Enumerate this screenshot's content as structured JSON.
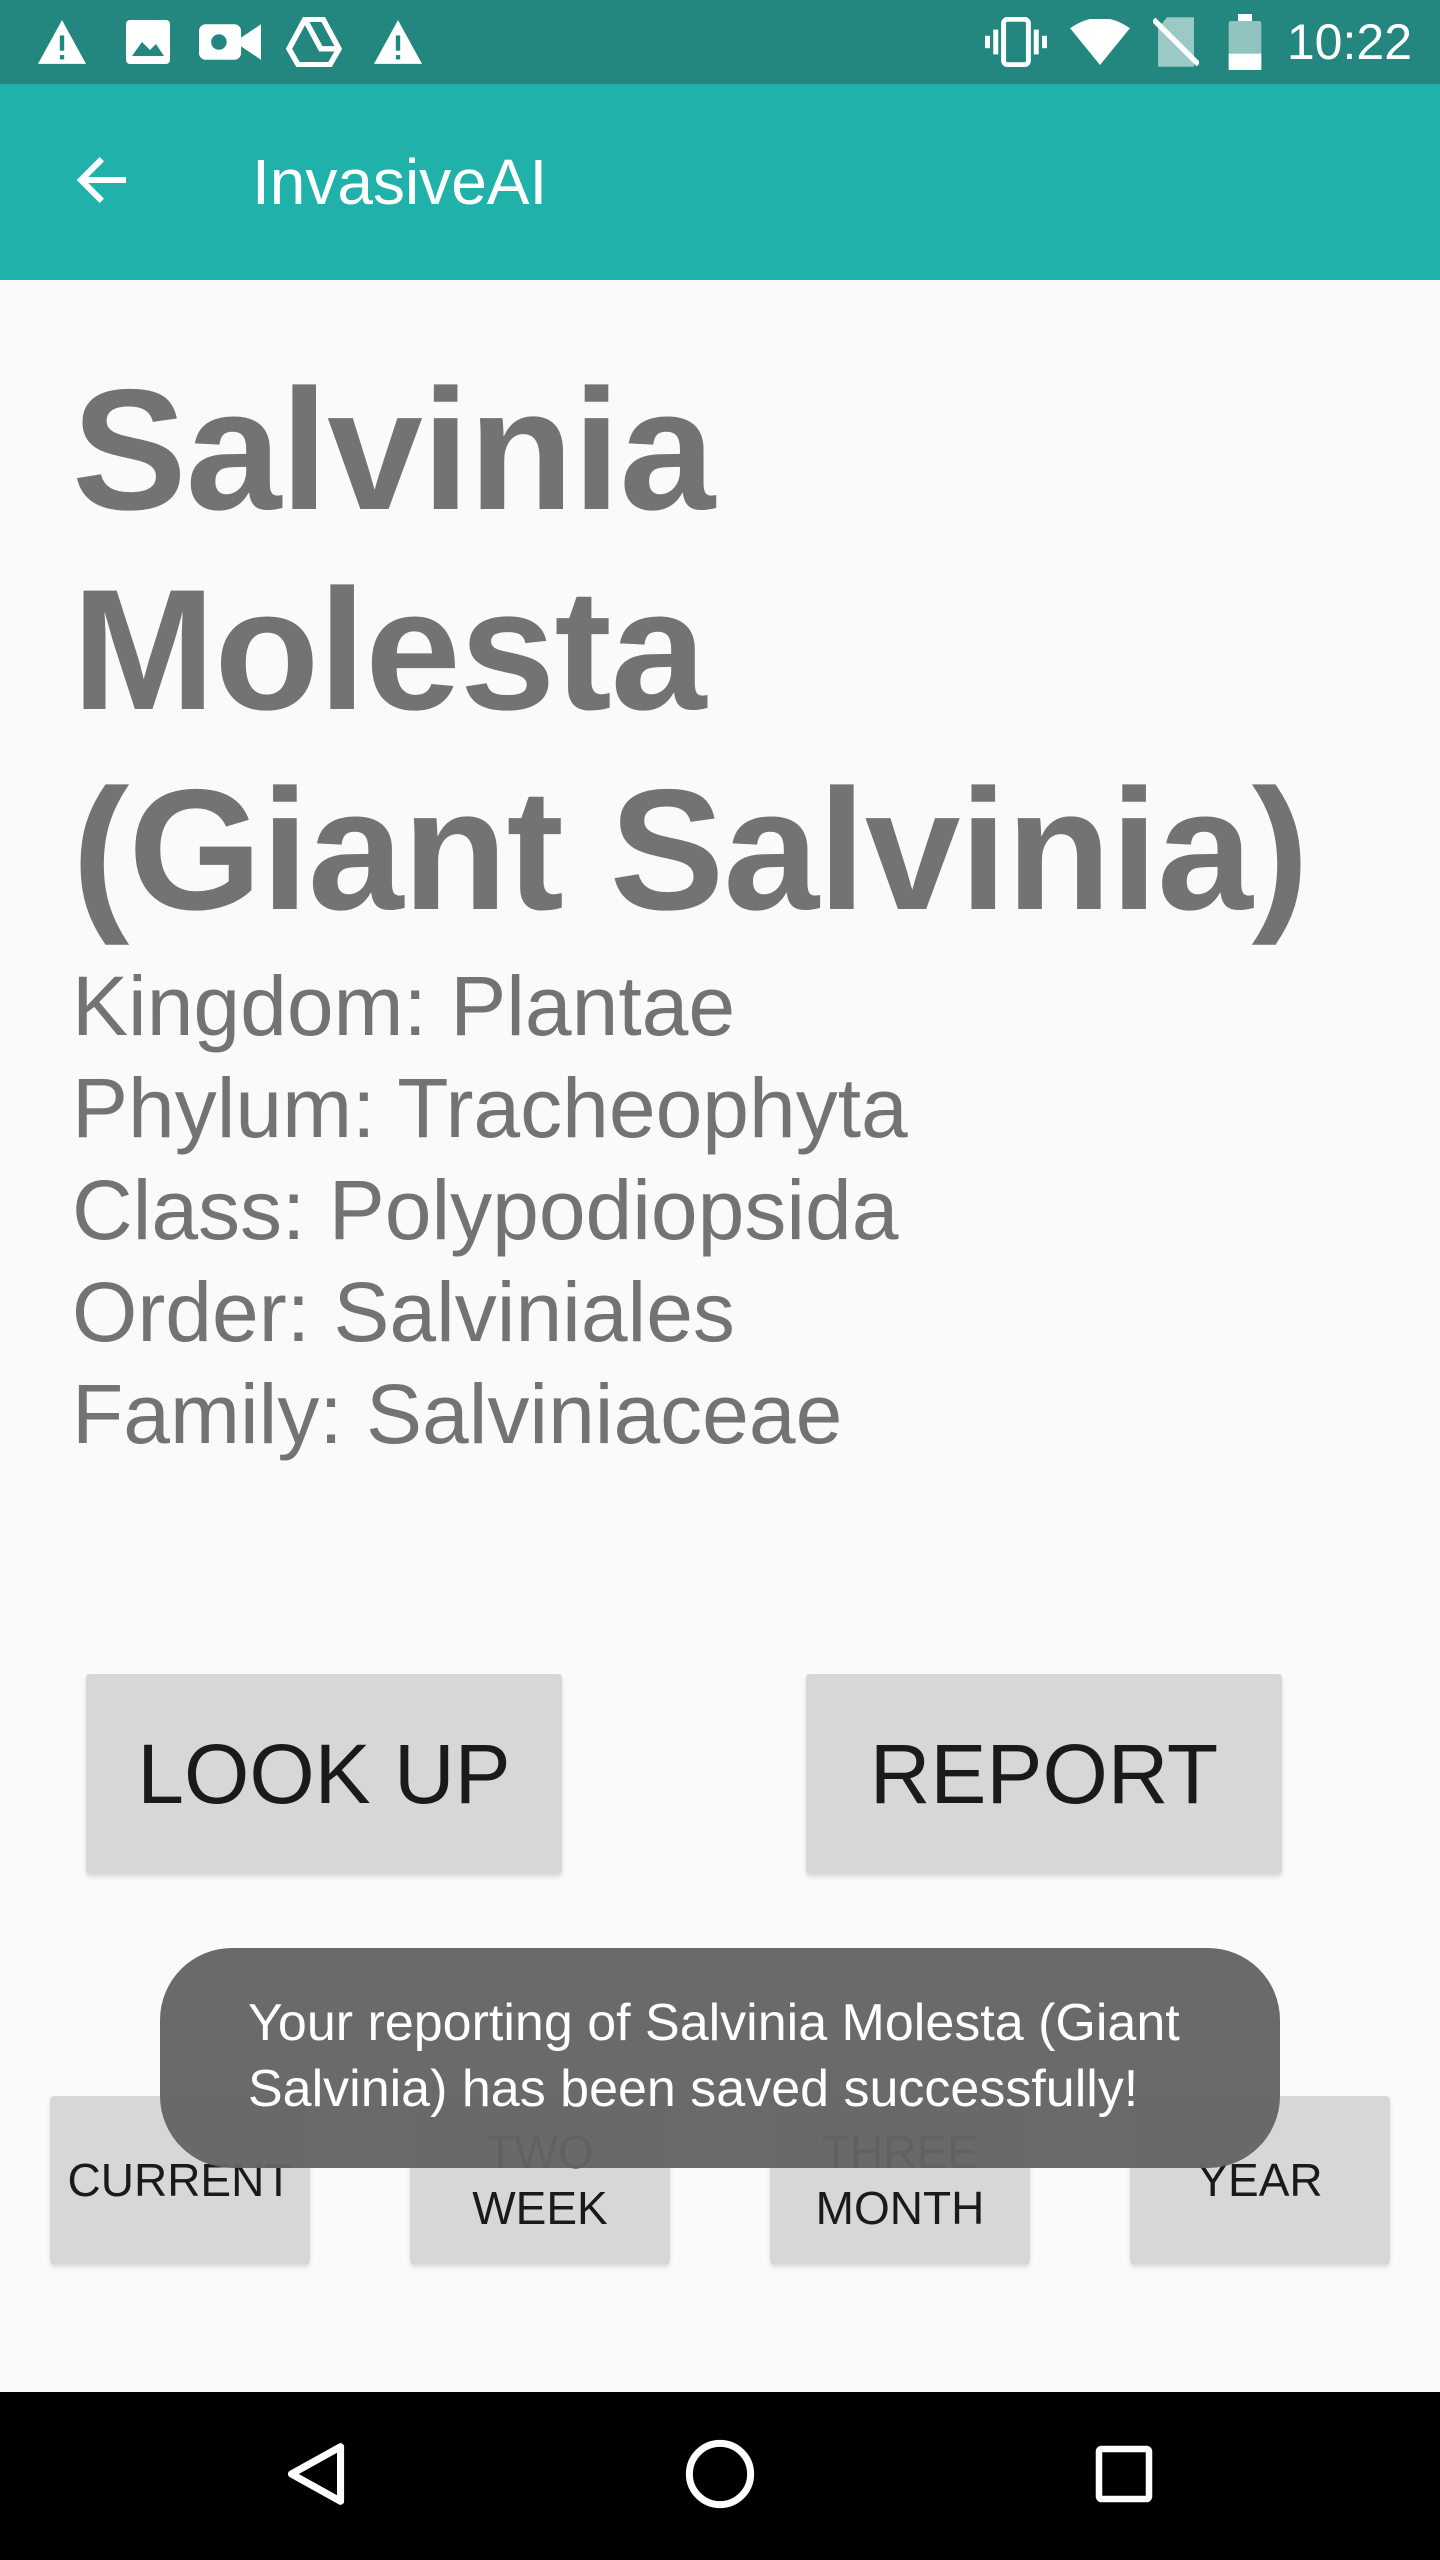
{
  "status_bar": {
    "time": "10:22",
    "left_icons": [
      "warning-icon",
      "image-icon",
      "video-camera-icon",
      "drive-icon",
      "warning-icon"
    ],
    "right_icons": [
      "vibrate-icon",
      "wifi-icon",
      "no-sim-icon",
      "battery-icon"
    ]
  },
  "app_bar": {
    "title": "InvasiveAI",
    "back_icon": "arrow-back-icon",
    "color": "#20b2aa"
  },
  "species": {
    "title_line1": "Salvinia Molesta",
    "title_line2": "(Giant Salvinia)",
    "taxonomy": [
      "Kingdom: Plantae",
      "Phylum: Tracheophyta",
      "Class: Polypodiopsida",
      "Order: Salviniales",
      "Family: Salviniaceae"
    ]
  },
  "actions": {
    "look_up": "LOOK UP",
    "report": "REPORT"
  },
  "range_buttons": {
    "current": "CURRENT",
    "two_week_line1": "TWO",
    "two_week_line2": "WEEK",
    "three_month_line1": "THREE",
    "three_month_line2": "MONTH",
    "year": "YEAR"
  },
  "toast": {
    "line1": "Your reporting of Salvinia Molesta (Giant",
    "line2": "Salvinia) has been saved successfully!"
  },
  "nav_bar": {
    "icons": [
      "back-triangle-icon",
      "home-circle-icon",
      "recents-square-icon"
    ]
  }
}
